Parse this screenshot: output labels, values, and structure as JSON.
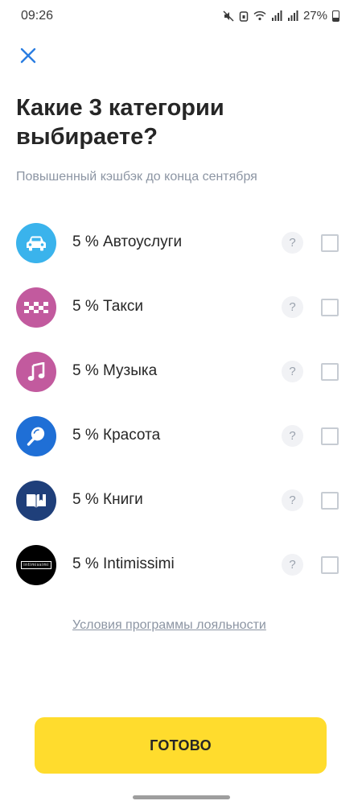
{
  "status_bar": {
    "time": "09:26",
    "battery": "27%"
  },
  "header": {
    "close_icon": "close-icon",
    "title": "Какие 3 категории выбираете?",
    "subtitle": "Повышенный кэшбэк до конца сентября"
  },
  "categories": [
    {
      "label": "5 % Автоуслуги",
      "icon": "car-icon",
      "color": "#3ab3ec",
      "checked": false
    },
    {
      "label": "5 % Такси",
      "icon": "taxi-icon",
      "color": "#c25a9e",
      "checked": false
    },
    {
      "label": "5 % Музыка",
      "icon": "music-note-icon",
      "color": "#c25a9e",
      "checked": false
    },
    {
      "label": "5 % Красота",
      "icon": "mirror-icon",
      "color": "#1f6fd6",
      "checked": false
    },
    {
      "label": "5 % Книги",
      "icon": "book-icon",
      "color": "#1f3f7a",
      "checked": false
    },
    {
      "label": "5 % Intimissimi",
      "icon": "intimissimi-logo",
      "logo_text": "intimissimi",
      "color": "#000000",
      "checked": false
    }
  ],
  "help_symbol": "?",
  "terms_link": "Условия программы лояльности",
  "done_button": "ГОТОВО",
  "colors": {
    "accent_button": "#ffdc2d",
    "close_icon": "#2a7de1",
    "muted_text": "#8c95a3"
  }
}
